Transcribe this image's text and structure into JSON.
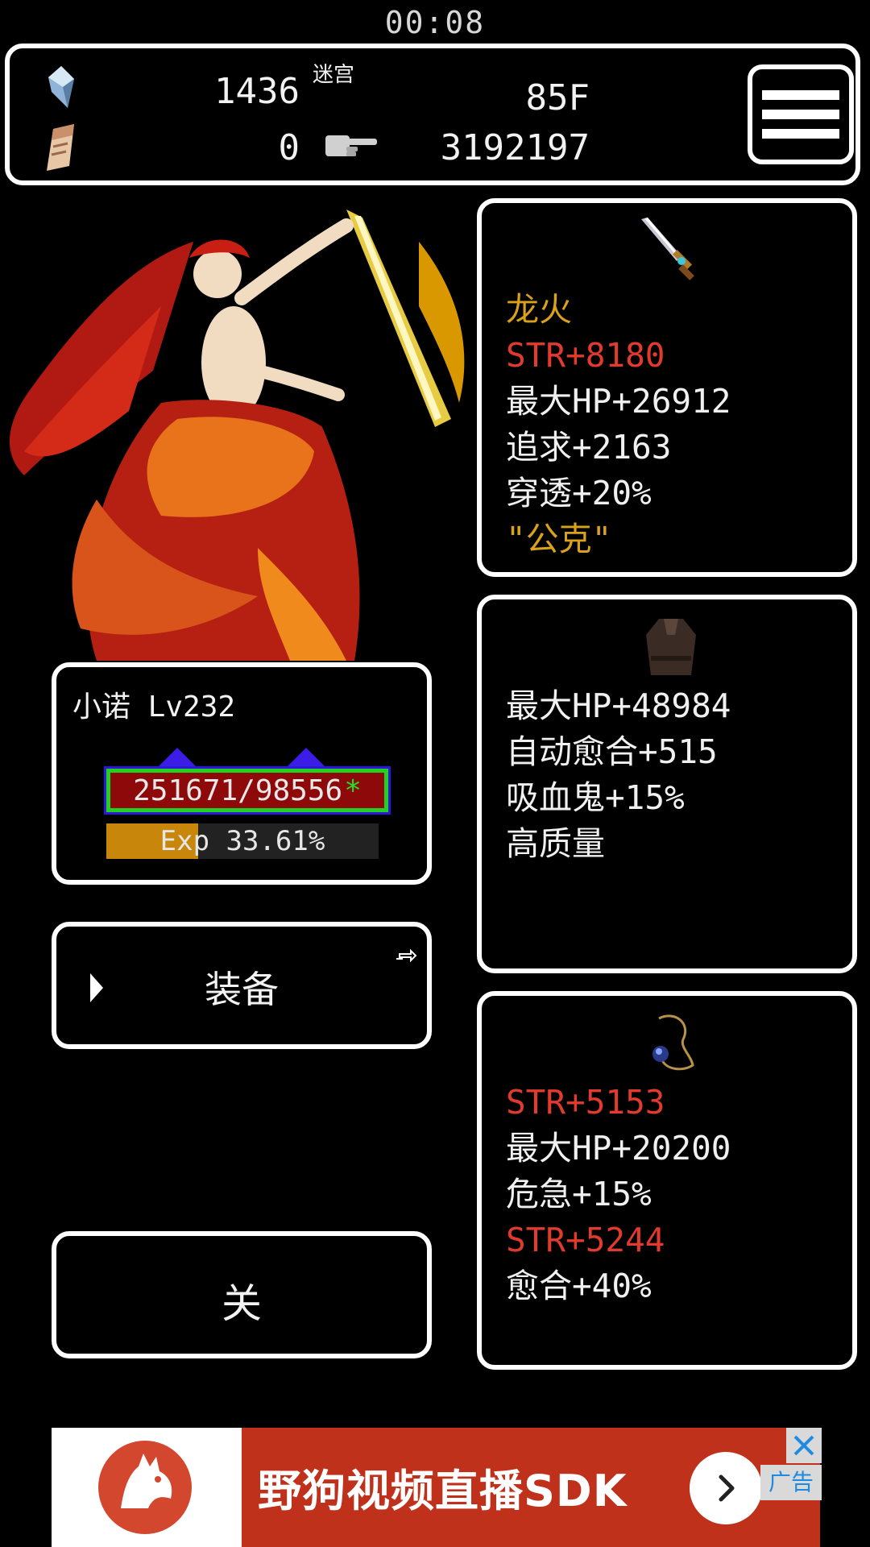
{
  "clock": "00:08",
  "header": {
    "crystal_count": "1436",
    "scroll_count": "0",
    "maze_label": "迷宫",
    "floor": "85F",
    "distance": "3192197",
    "icons": {
      "crystal": "crystal-icon",
      "scroll": "scroll-icon",
      "pointer": "pointing-hand-icon",
      "menu": "hamburger-menu-icon"
    }
  },
  "character": {
    "name_level": "小诺 Lv232",
    "hp_text": "251671/98556",
    "hp_mark": "*",
    "exp_text": "Exp 33.61%",
    "exp_progress": 0.3361,
    "colors": {
      "hp_bar": "#8e0a0a",
      "hp_border": "#23d123",
      "exp_fill": "#c8870a",
      "marker": "#3b1de6"
    }
  },
  "buttons": {
    "equip_label": "装备",
    "close_label": "关"
  },
  "items": {
    "weapon": {
      "icon": "sword-icon",
      "lines": [
        {
          "text": "龙火",
          "color": "gold"
        },
        {
          "text": "STR+8180",
          "color": "red"
        },
        {
          "text": "最大HP+26912",
          "color": "white"
        },
        {
          "text": "追求+2163",
          "color": "white"
        },
        {
          "text": "穿透+20%",
          "color": "white"
        },
        {
          "text": "\"公克\"",
          "color": "gold"
        }
      ]
    },
    "armor": {
      "icon": "robe-icon",
      "lines": [
        {
          "text": "最大HP+48984",
          "color": "white"
        },
        {
          "text": "自动愈合+515",
          "color": "white"
        },
        {
          "text": "吸血鬼+15%",
          "color": "white"
        },
        {
          "text": "高质量",
          "color": "white"
        }
      ]
    },
    "accessory": {
      "icon": "amulet-icon",
      "lines": [
        {
          "text": "STR+5153",
          "color": "red"
        },
        {
          "text": "最大HP+20200",
          "color": "white"
        },
        {
          "text": "危急+15%",
          "color": "white"
        },
        {
          "text": "STR+5244",
          "color": "red"
        },
        {
          "text": "愈合+40%",
          "color": "white"
        }
      ]
    }
  },
  "ad": {
    "text": "野狗视频直播SDK",
    "tag": "广告",
    "logo": "wild-dog-logo",
    "brand_color": "#c0311c"
  }
}
